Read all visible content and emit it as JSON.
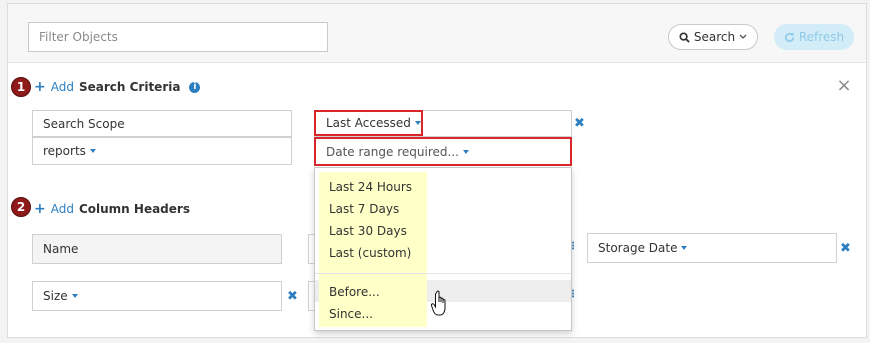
{
  "topbar": {
    "filter_placeholder": "Filter Objects",
    "search_label": "Search",
    "refresh_label": "Refresh"
  },
  "search_criteria": {
    "badge": "1",
    "add_label": "Add",
    "title": "Search Criteria",
    "scope_label": "Search Scope",
    "scope_value": "reports",
    "field_label": "Last Accessed",
    "range_placeholder": "Date range required..."
  },
  "column_headers": {
    "badge": "2",
    "add_label": "Add",
    "title": "Column Headers",
    "col_name": "Name",
    "col_size": "Size",
    "col_storage_date": "Storage Date"
  },
  "date_menu": {
    "items": [
      "Last 24 Hours",
      "Last 7 Days",
      "Last 30 Days",
      "Last (custom)",
      "Before...",
      "Since..."
    ]
  },
  "colors": {
    "accent": "#2d7fc1",
    "badge": "#8e1a1a",
    "highlight_outline": "#d9262b",
    "menu_highlight": "#ffffc8"
  }
}
